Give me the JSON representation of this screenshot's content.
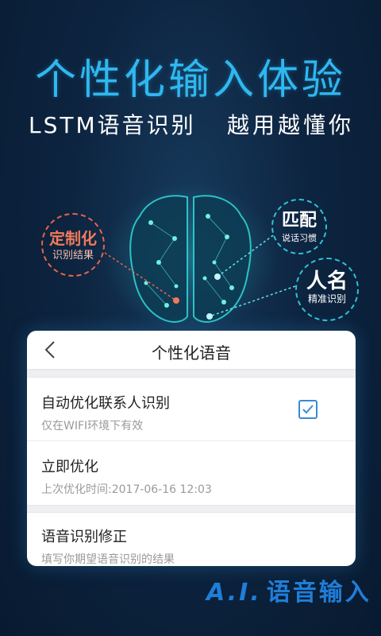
{
  "hero": {
    "title": "个性化输入体验",
    "subtitle_left": "LSTM语音识别",
    "subtitle_right": "越用越懂你"
  },
  "bubbles": {
    "custom": {
      "title": "定制化",
      "desc": "识别结果"
    },
    "match": {
      "title": "匹配",
      "desc": "说话习惯"
    },
    "name": {
      "title": "人名",
      "desc": "精准识别"
    }
  },
  "card": {
    "title": "个性化语音",
    "items": [
      {
        "title": "自动优化联系人识别",
        "desc": "仅在WIFI环境下有效",
        "checked": true
      },
      {
        "title": "立即优化",
        "desc": "上次优化时间:2017-06-16 12:03"
      },
      {
        "title": "语音识别修正",
        "desc": "填写你期望语音识别的结果"
      }
    ]
  },
  "logo": {
    "ai": "A.I.",
    "text": "语音输入"
  },
  "colors": {
    "accent": "#2fb8f0",
    "orange": "#e8644a",
    "checkbox": "#3a8bd6",
    "logo": "#1f7ed8"
  },
  "icons": [
    "back-icon",
    "check-icon",
    "brain-illustration"
  ]
}
